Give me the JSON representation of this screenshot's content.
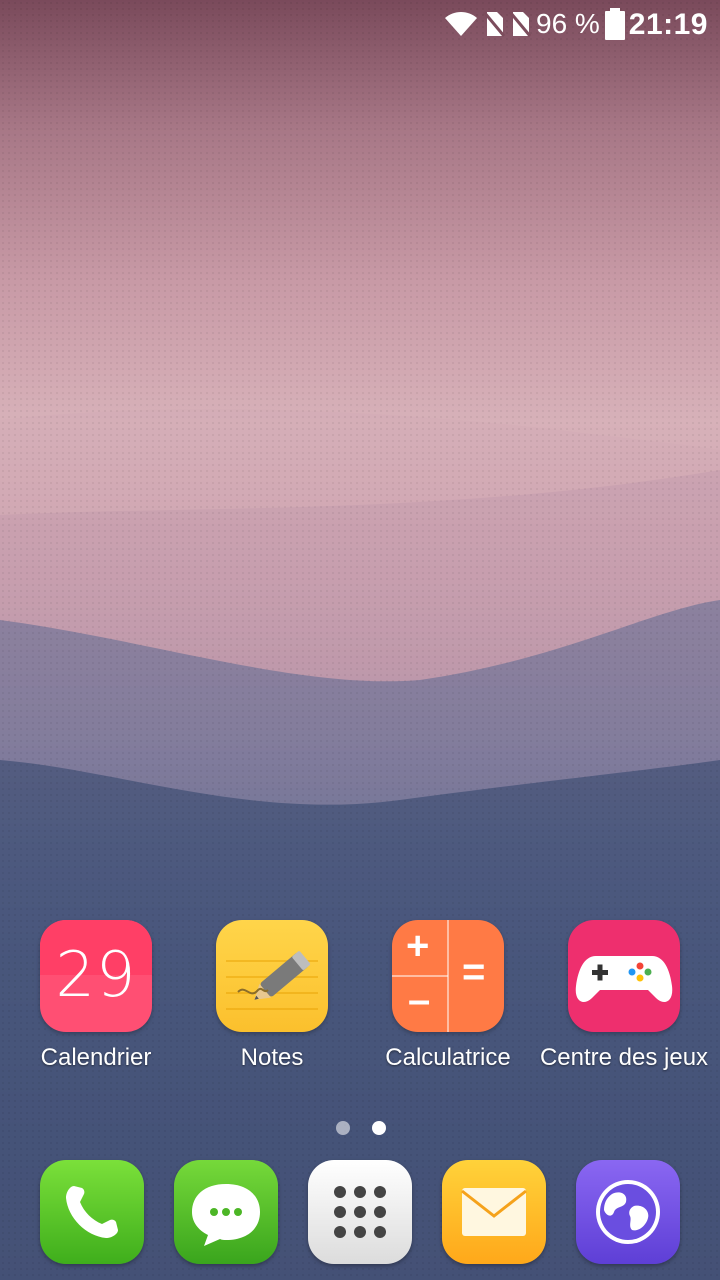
{
  "status_bar": {
    "battery_percent": "96 %",
    "time": "21:19",
    "icons": [
      "wifi-icon",
      "no-sim-icon",
      "no-sim-icon",
      "battery-icon"
    ]
  },
  "home_apps": [
    {
      "label": "Calendrier",
      "icon": "calendar-icon",
      "day": "29"
    },
    {
      "label": "Notes",
      "icon": "notes-icon"
    },
    {
      "label": "Calculatrice",
      "icon": "calculator-icon"
    },
    {
      "label": "Centre des jeux",
      "icon": "gamepad-icon"
    }
  ],
  "page_indicator": {
    "count": 2,
    "active": 2
  },
  "dock": [
    {
      "icon": "phone-icon"
    },
    {
      "icon": "messages-icon"
    },
    {
      "icon": "app-drawer-icon"
    },
    {
      "icon": "mail-icon"
    },
    {
      "icon": "browser-globe-icon"
    }
  ],
  "colors": {
    "calendar": "#ff4f73",
    "notes": "#fbc02d",
    "calculator": "#ff7a45",
    "games": "#ee2f6e",
    "phone": "#4cbf22",
    "messages": "#4cb626",
    "mail": "#ffb726",
    "browser": "#7352e6"
  }
}
